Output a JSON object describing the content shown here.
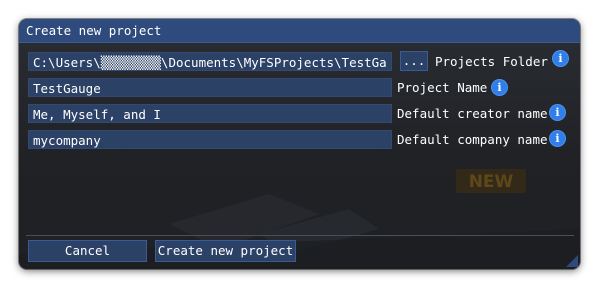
{
  "dialog": {
    "title": "Create new project"
  },
  "folder": {
    "path": "C:\\Users\\▒▒▒▒▒▒▒▒\\Documents\\MyFSProjects\\TestGauge",
    "browse_label": "...",
    "label": "Projects Folder"
  },
  "project_name": {
    "value": "TestGauge",
    "label": "Project Name"
  },
  "creator_name": {
    "value": "Me, Myself, and I",
    "label": "Default creator name"
  },
  "company_name": {
    "value": "mycompany",
    "label": "Default company name"
  },
  "actions": {
    "cancel_label": "Cancel",
    "create_label": "Create new project"
  },
  "background": {
    "badge_text": "NEW"
  },
  "icons": {
    "info": "info-icon",
    "resize": "resize-grip-icon"
  },
  "colors": {
    "titlebar": "#2f4a7c",
    "field": "#2c4166",
    "info_icon": "#2f7ee9",
    "dialog_bg": "#202226"
  }
}
